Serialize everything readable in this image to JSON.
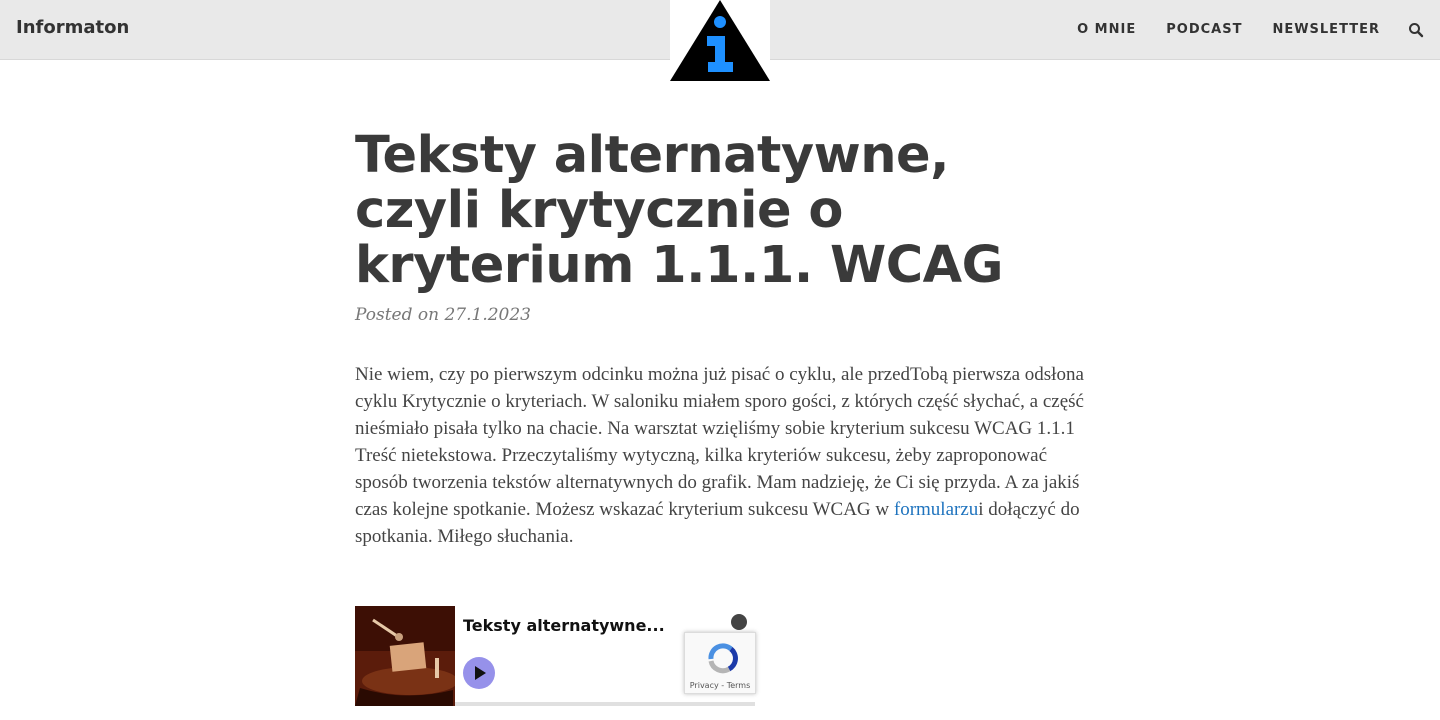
{
  "header": {
    "site_title": "Informaton",
    "nav": [
      {
        "label": "O MNIE"
      },
      {
        "label": "PODCAST"
      },
      {
        "label": "NEWSLETTER"
      }
    ],
    "search_icon": "search-icon",
    "logo_icon": "info-triangle-logo",
    "logo_colors": {
      "triangle": "#000000",
      "glyph": "#1e90ff"
    }
  },
  "article": {
    "title": "Teksty alternatywne, czyli krytycznie o kryterium 1.1.1. WCAG",
    "posted": "Posted on 27.1.2023",
    "body_before_link": "Nie wiem, czy po pierwszym odcinku można już pisać o cyklu, ale przedTobą pierwsza odsłona cyklu Krytycznie o kryteriach. W saloniku miałem sporo gości, z których część słychać, a część nieśmiało pisała tylko na chacie. Na warsztat wzięliśmy sobie kryterium sukcesu WCAG 1.1.1 Treść nietekstowa. Przeczytaliśmy wytyczną, kilka kryteriów sukcesu, żeby zaproponować sposób tworzenia tekstów alternatywnych do grafik. Mam nadzieję, że Ci się przyda. A za jakiś czas kolejne spotkanie. Możesz wskazać kryterium sukcesu WCAG w ",
    "link_text": "formularzu",
    "body_after_link": "i dołączyć do spotkania. Miłego słuchania.",
    "link_color": "#1e73be"
  },
  "player": {
    "episode_title": "Teksty alternatywne...",
    "play_icon": "play-icon",
    "spotify_icon": "spotify-icon",
    "play_color": "#9691ea"
  },
  "recaptcha": {
    "links": "Privacy - Terms",
    "icon": "recaptcha-icon"
  }
}
